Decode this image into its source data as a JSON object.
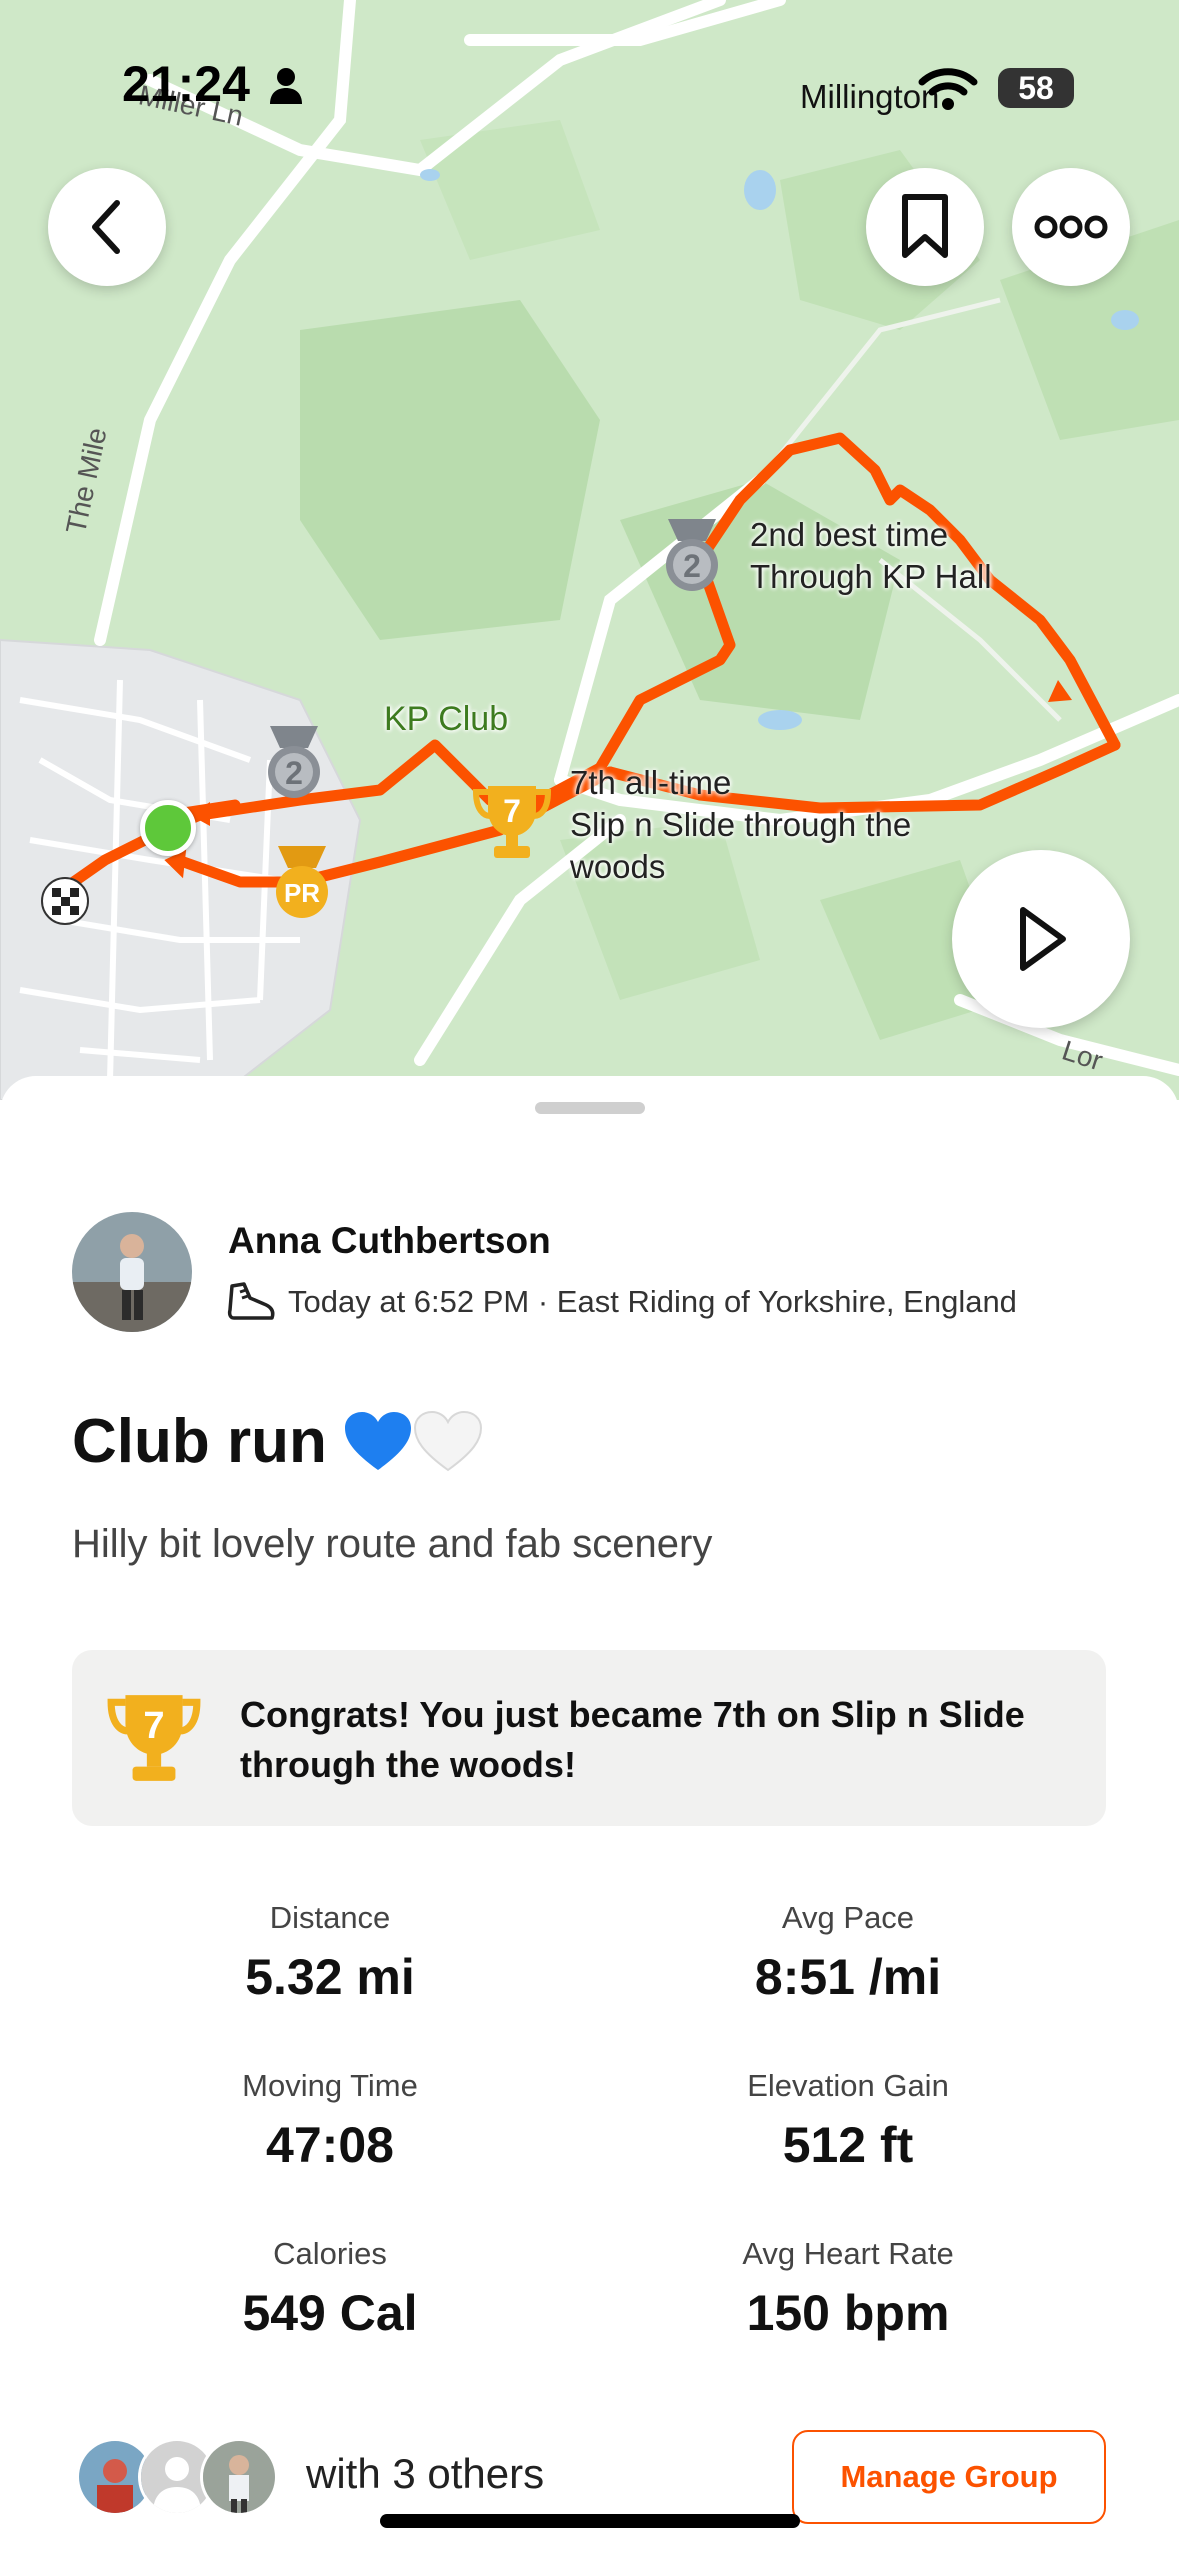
{
  "status_bar": {
    "time": "21:24",
    "location": "Millington",
    "battery": "58"
  },
  "map": {
    "road_labels": {
      "miller_ln": "Miller Ln",
      "the_mile": "The Mile",
      "lor": "Lor"
    },
    "annotations": {
      "kp_hall_line1": "2nd best time",
      "kp_hall_line2": "Through KP Hall",
      "kp_club": "KP Club",
      "slide_line1": "7th all-time",
      "slide_line2": "Slip n Slide through the",
      "slide_line3": "woods"
    },
    "markers": {
      "medal_kp_hall": "2",
      "medal_kp_club": "2",
      "trophy_slide": "7",
      "pr_badge": "PR"
    },
    "route_color": "#FC5200"
  },
  "athlete": {
    "name": "Anna Cuthbertson",
    "meta": "Today at 6:52 PM · East Riding of Yorkshire, England"
  },
  "activity": {
    "title": "Club run",
    "description": "Hilly bit lovely route and fab scenery"
  },
  "congrats": {
    "rank": "7",
    "text": "Congrats! You just became 7th on Slip n Slide through the woods!"
  },
  "stats": {
    "distance_label": "Distance",
    "distance_value": "5.32 mi",
    "pace_label": "Avg Pace",
    "pace_value": "8:51 /mi",
    "moving_time_label": "Moving Time",
    "moving_time_value": "47:08",
    "elevation_label": "Elevation Gain",
    "elevation_value": "512 ft",
    "calories_label": "Calories",
    "calories_value": "549 Cal",
    "heart_rate_label": "Avg Heart Rate",
    "heart_rate_value": "150 bpm"
  },
  "group": {
    "text": "with 3 others",
    "manage_label": "Manage Group"
  },
  "colors": {
    "brand": "#FC5200",
    "medal_silver": "#8A8F96",
    "trophy_gold": "#F2B01E",
    "map_green": "#CDE8C6"
  }
}
